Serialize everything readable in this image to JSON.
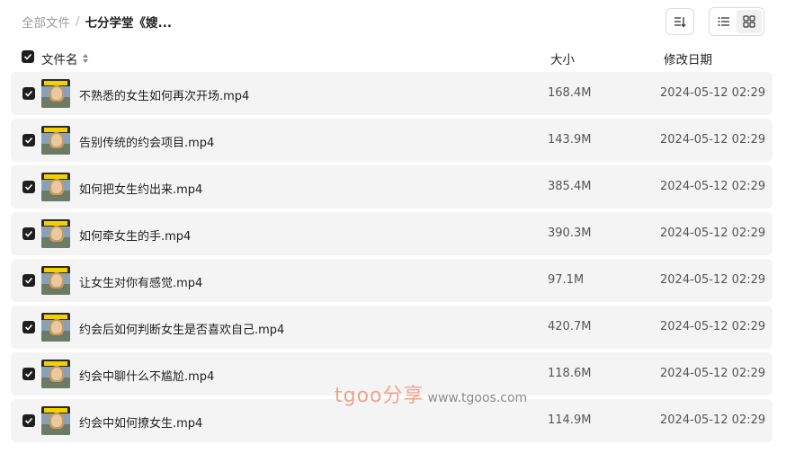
{
  "breadcrumb": {
    "root": "全部文件",
    "separator": "/",
    "current": "七分学堂《嫂..."
  },
  "toolbar": {
    "sort_icon": "sort-icon",
    "list_view_icon": "list-view-icon",
    "grid_view_icon": "grid-view-icon",
    "active_view": "list"
  },
  "columns": {
    "name": "文件名",
    "size": "大小",
    "modified": "修改日期"
  },
  "files": [
    {
      "name": "不熟悉的女生如何再次开场.mp4",
      "size": "168.4M",
      "modified": "2024-05-12 02:29",
      "checked": true
    },
    {
      "name": "告别传统的约会项目.mp4",
      "size": "143.9M",
      "modified": "2024-05-12 02:29",
      "checked": true
    },
    {
      "name": "如何把女生约出来.mp4",
      "size": "385.4M",
      "modified": "2024-05-12 02:29",
      "checked": true
    },
    {
      "name": "如何牵女生的手.mp4",
      "size": "390.3M",
      "modified": "2024-05-12 02:29",
      "checked": true
    },
    {
      "name": "让女生对你有感觉.mp4",
      "size": "97.1M",
      "modified": "2024-05-12 02:29",
      "checked": true
    },
    {
      "name": "约会后如何判断女生是否喜欢自己.mp4",
      "size": "420.7M",
      "modified": "2024-05-12 02:29",
      "checked": true
    },
    {
      "name": "约会中聊什么不尴尬.mp4",
      "size": "118.6M",
      "modified": "2024-05-12 02:29",
      "checked": true
    },
    {
      "name": "约会中如何撩女生.mp4",
      "size": "114.9M",
      "modified": "2024-05-12 02:29",
      "checked": true
    }
  ],
  "watermark": {
    "brand": "tgoo分享",
    "url": "www.tgoos.com"
  },
  "colors": {
    "row_bg": "#f4f4f5",
    "checkbox": "#1f1f1f",
    "watermark": "#f0a38a"
  }
}
